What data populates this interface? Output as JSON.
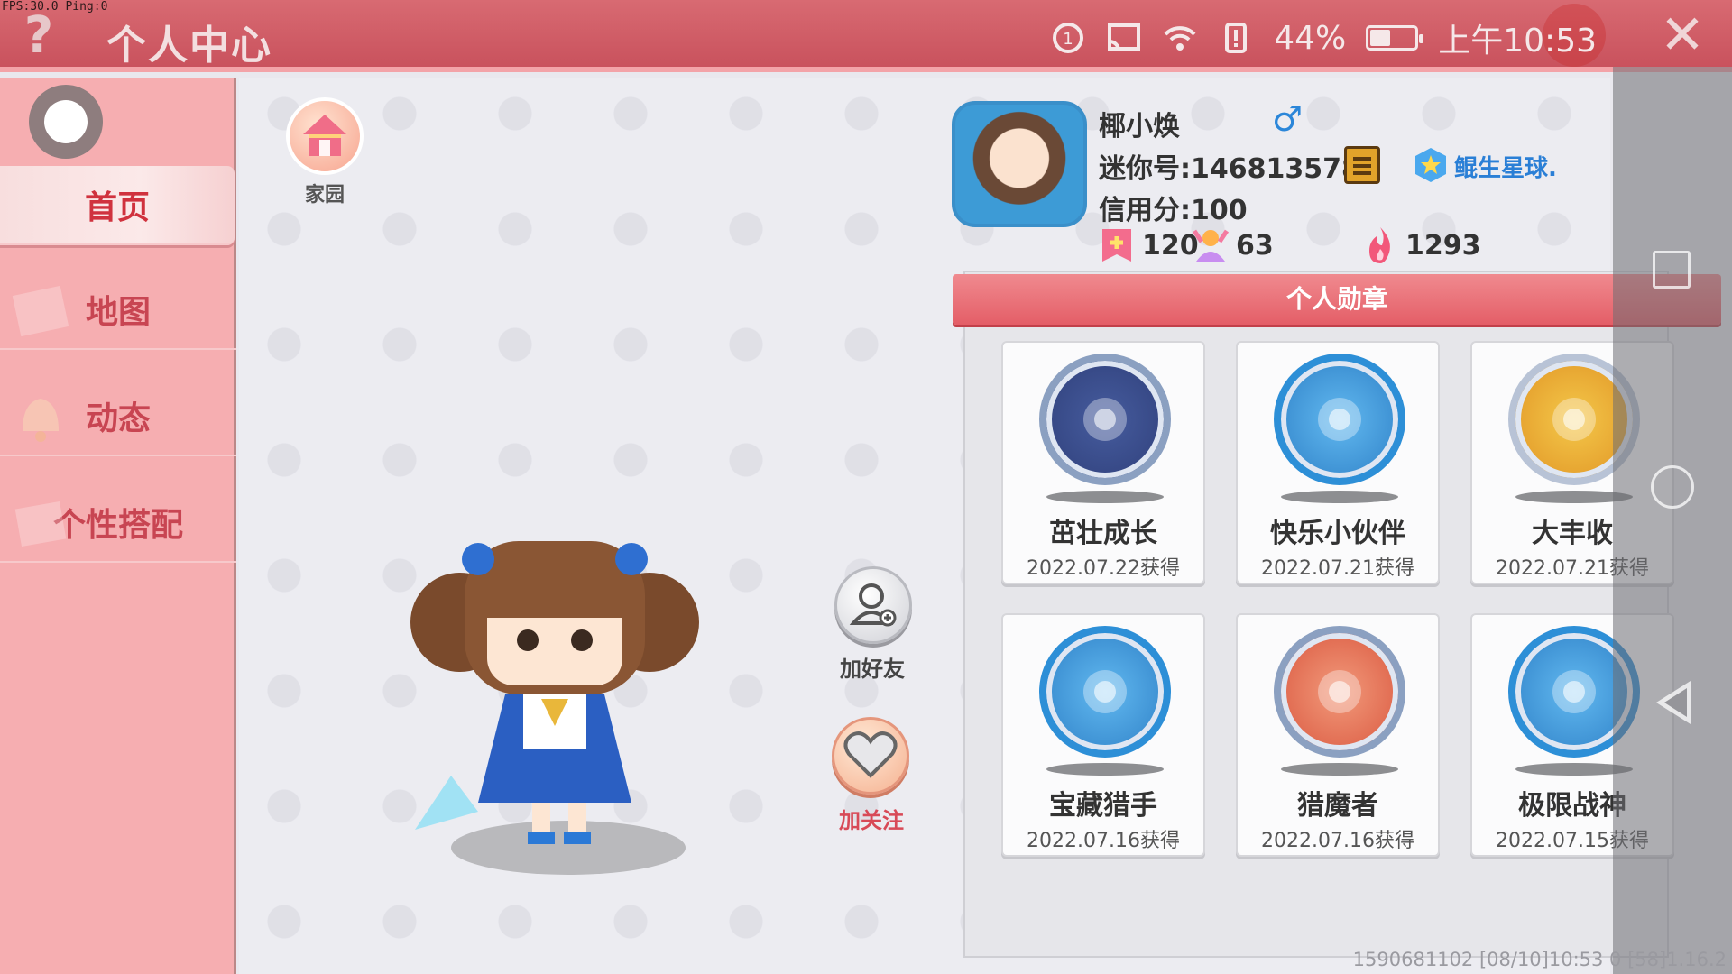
{
  "debug": {
    "fps": "FPS:30.0  Ping:0"
  },
  "header": {
    "title": "个人中心",
    "battery_percent": "44%",
    "battery_level": 0.44,
    "time": "上午10:53"
  },
  "sidebar": {
    "items": [
      {
        "label": "首页",
        "active": true
      },
      {
        "label": "地图",
        "active": false
      },
      {
        "label": "动态",
        "active": false
      },
      {
        "label": "个性搭配",
        "active": false
      }
    ]
  },
  "home": {
    "label": "家园"
  },
  "actions": {
    "add_friend": "加好友",
    "follow": "加关注"
  },
  "profile": {
    "name": "椰小焕",
    "gender_symbol": "♂",
    "id_text": "迷你号:1468135783",
    "planet": "鲲生星球.",
    "credit": "信用分:100",
    "stats": {
      "likes": "120",
      "fans": "63",
      "heat": "1293"
    }
  },
  "medals": {
    "title": "个人勋章",
    "items": [
      {
        "name": "茁壮成长",
        "date": "2022.07.22获得",
        "style": "silver"
      },
      {
        "name": "快乐小伙伴",
        "date": "2022.07.21获得",
        "style": "blue"
      },
      {
        "name": "大丰收",
        "date": "2022.07.21获得",
        "style": "gold"
      },
      {
        "name": "宝藏猎手",
        "date": "2022.07.16获得",
        "style": "blue"
      },
      {
        "name": "猎魔者",
        "date": "2022.07.16获得",
        "style": "red"
      },
      {
        "name": "极限战神",
        "date": "2022.07.15获得",
        "style": "blue"
      }
    ]
  },
  "footer": {
    "info": "1590681102   [08/10]10:53 0  [58]1.16.2"
  },
  "colors": {
    "topbar": "#c9525d",
    "sidebar": "#f6aeb1",
    "accent": "#e45e67",
    "link": "#2a7fd6"
  }
}
